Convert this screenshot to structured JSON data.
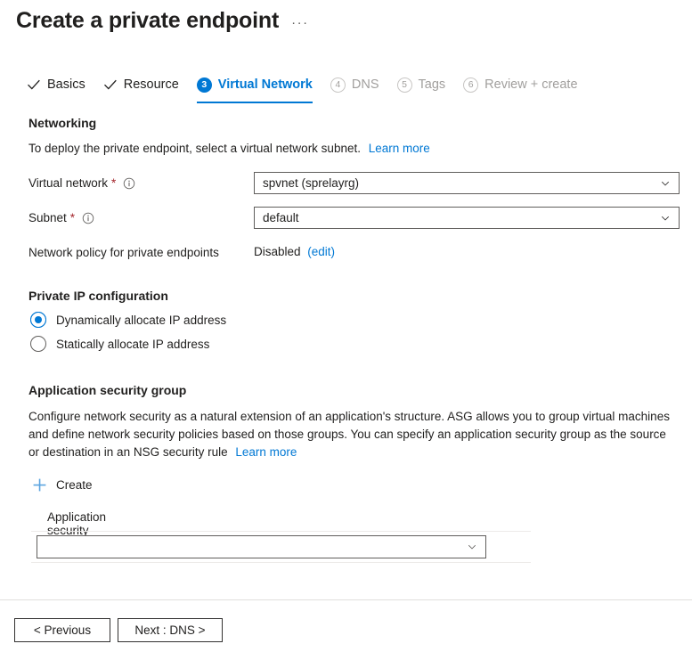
{
  "header": {
    "title": "Create a private endpoint",
    "more_label": "···"
  },
  "wizard": {
    "tabs": [
      {
        "label": "Basics",
        "state": "done",
        "marker": "check"
      },
      {
        "label": "Resource",
        "state": "done",
        "marker": "check"
      },
      {
        "label": "Virtual Network",
        "state": "active",
        "marker": "3"
      },
      {
        "label": "DNS",
        "state": "todo",
        "marker": "4"
      },
      {
        "label": "Tags",
        "state": "todo",
        "marker": "5"
      },
      {
        "label": "Review + create",
        "state": "todo",
        "marker": "6"
      }
    ]
  },
  "networking": {
    "heading": "Networking",
    "description": "To deploy the private endpoint, select a virtual network subnet.",
    "learn_more": "Learn more",
    "virtual_network": {
      "label": "Virtual network",
      "required_marker": "*",
      "value": "spvnet (sprelayrg)"
    },
    "subnet": {
      "label": "Subnet",
      "required_marker": "*",
      "value": "default"
    },
    "network_policy": {
      "label": "Network policy for private endpoints",
      "value": "Disabled",
      "edit_link": "(edit)"
    }
  },
  "private_ip": {
    "heading": "Private IP configuration",
    "options": [
      {
        "label": "Dynamically allocate IP address",
        "selected": true
      },
      {
        "label": "Statically allocate IP address",
        "selected": false
      }
    ]
  },
  "asg": {
    "heading": "Application security group",
    "description": "Configure network security as a natural extension of an application's structure. ASG allows you to group virtual machines and define network security policies based on those groups. You can specify an application security group as the source or destination in an NSG security rule",
    "learn_more": "Learn more",
    "create_label": "Create",
    "column_header": "Application security group",
    "selected_value": ""
  },
  "footer": {
    "previous_label": "< Previous",
    "next_label": "Next : DNS >"
  },
  "colors": {
    "accent": "#0078d4",
    "link": "#0078d4",
    "required": "#a4262c",
    "disabled_text": "#a19f9d",
    "plus_icon": "#5ba4e0"
  }
}
